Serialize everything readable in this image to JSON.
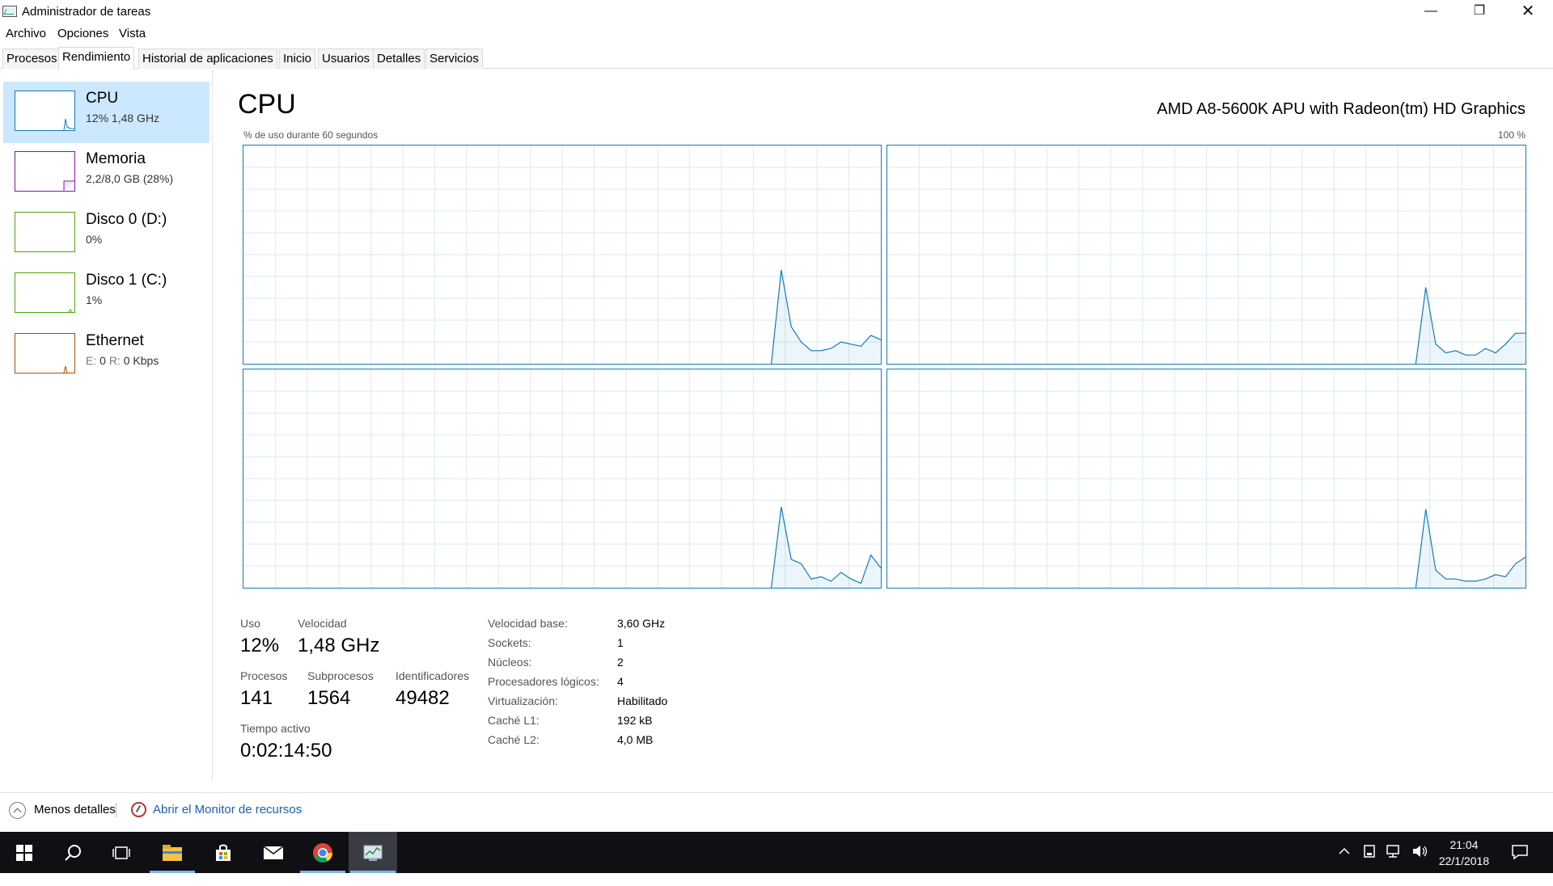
{
  "window": {
    "title": "Administrador de tareas",
    "minimize": "—",
    "maximize": "❐",
    "close": "✕"
  },
  "menu": [
    "Archivo",
    "Opciones",
    "Vista"
  ],
  "tabs": [
    "Procesos",
    "Rendimiento",
    "Historial de aplicaciones",
    "Inicio",
    "Usuarios",
    "Detalles",
    "Servicios"
  ],
  "active_tab": "Rendimiento",
  "sidebar": [
    {
      "name": "CPU",
      "sub": "12%  1,48 GHz",
      "color": "#117dbb"
    },
    {
      "name": "Memoria",
      "sub": "2,2/8,0 GB (28%)",
      "color": "#8b12ae"
    },
    {
      "name": "Disco 0 (D:)",
      "sub": "0%",
      "color": "#4da60c"
    },
    {
      "name": "Disco 1 (C:)",
      "sub": "1%",
      "color": "#4da60c"
    },
    {
      "name": "Ethernet",
      "sub_prefix_e": "E:",
      "sub_e": "0",
      "sub_prefix_r": "R:",
      "sub_r": "0 Kbps",
      "color": "#a74f01"
    }
  ],
  "main": {
    "title": "CPU",
    "model": "AMD A8-5600K APU with Radeon(tm) HD Graphics",
    "graph_caption": "% de uso durante 60 segundos",
    "graph_max": "100 %",
    "accent": "#117dbb",
    "cores": [
      {
        "usage_history": [
          0,
          0,
          0,
          0,
          0,
          0,
          0,
          0,
          0,
          0,
          0,
          0,
          0,
          0,
          0,
          0,
          0,
          0,
          0,
          0,
          0,
          0,
          0,
          0,
          0,
          0,
          0,
          0,
          0,
          0,
          0,
          0,
          0,
          0,
          0,
          0,
          0,
          0,
          0,
          0,
          0,
          0,
          0,
          0,
          0,
          0,
          0,
          0,
          0,
          0,
          0,
          0,
          0,
          0,
          43,
          17,
          10,
          6,
          6,
          7,
          10,
          9,
          8,
          13,
          11
        ]
      },
      {
        "usage_history": [
          0,
          0,
          0,
          0,
          0,
          0,
          0,
          0,
          0,
          0,
          0,
          0,
          0,
          0,
          0,
          0,
          0,
          0,
          0,
          0,
          0,
          0,
          0,
          0,
          0,
          0,
          0,
          0,
          0,
          0,
          0,
          0,
          0,
          0,
          0,
          0,
          0,
          0,
          0,
          0,
          0,
          0,
          0,
          0,
          0,
          0,
          0,
          0,
          0,
          0,
          0,
          0,
          0,
          0,
          35,
          9,
          5,
          6,
          4,
          4,
          7,
          5,
          9,
          14,
          14
        ]
      },
      {
        "usage_history": [
          0,
          0,
          0,
          0,
          0,
          0,
          0,
          0,
          0,
          0,
          0,
          0,
          0,
          0,
          0,
          0,
          0,
          0,
          0,
          0,
          0,
          0,
          0,
          0,
          0,
          0,
          0,
          0,
          0,
          0,
          0,
          0,
          0,
          0,
          0,
          0,
          0,
          0,
          0,
          0,
          0,
          0,
          0,
          0,
          0,
          0,
          0,
          0,
          0,
          0,
          0,
          0,
          0,
          0,
          37,
          13,
          11,
          4,
          5,
          3,
          7,
          4,
          2,
          15,
          9
        ]
      },
      {
        "usage_history": [
          0,
          0,
          0,
          0,
          0,
          0,
          0,
          0,
          0,
          0,
          0,
          0,
          0,
          0,
          0,
          0,
          0,
          0,
          0,
          0,
          0,
          0,
          0,
          0,
          0,
          0,
          0,
          0,
          0,
          0,
          0,
          0,
          0,
          0,
          0,
          0,
          0,
          0,
          0,
          0,
          0,
          0,
          0,
          0,
          0,
          0,
          0,
          0,
          0,
          0,
          0,
          0,
          0,
          0,
          36,
          8,
          4,
          4,
          3,
          3,
          4,
          6,
          5,
          11,
          14
        ]
      }
    ],
    "stats": {
      "uso_label": "Uso",
      "uso": "12%",
      "velocidad_label": "Velocidad",
      "velocidad": "1,48 GHz",
      "procesos_label": "Procesos",
      "procesos": "141",
      "subprocesos_label": "Subprocesos",
      "subprocesos": "1564",
      "identificadores_label": "Identificadores",
      "identificadores": "49482",
      "tiempo_label": "Tiempo activo",
      "tiempo": "0:02:14:50"
    },
    "details": [
      {
        "key": "Velocidad base:",
        "value": "3,60 GHz"
      },
      {
        "key": "Sockets:",
        "value": "1"
      },
      {
        "key": "Núcleos:",
        "value": "2"
      },
      {
        "key": "Procesadores lógicos:",
        "value": "4"
      },
      {
        "key": "Virtualización:",
        "value": "Habilitado"
      },
      {
        "key": "Caché L1:",
        "value": "192 kB"
      },
      {
        "key": "Caché L2:",
        "value": "4,0 MB"
      }
    ]
  },
  "footer": {
    "less_details": "Menos detalles",
    "resource_monitor": "Abrir el Monitor de recursos"
  },
  "taskbar": {
    "time": "21:04",
    "date": "22/1/2018",
    "icons": [
      "windows-start-icon",
      "search-icon",
      "task-view-icon",
      "file-explorer-icon",
      "store-icon",
      "mail-icon",
      "chrome-icon",
      "task-manager-icon"
    ]
  }
}
